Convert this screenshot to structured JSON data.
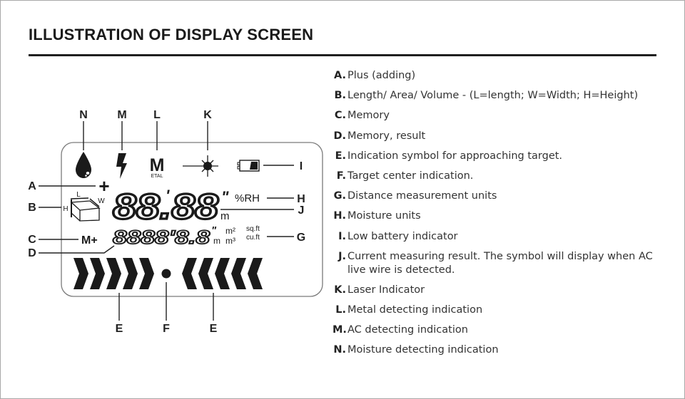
{
  "page": {
    "title": "ILLUSTRATION OF DISPLAY SCREEN"
  },
  "diagram": {
    "callouts": {
      "A": "A",
      "B": "B",
      "C": "C",
      "D": "D",
      "E": "E",
      "F": "F",
      "G": "G",
      "H": "H",
      "I": "I",
      "J": "J",
      "K": "K",
      "L": "L",
      "M": "M",
      "N": "N"
    },
    "lcd": {
      "metal_icon_letter": "M",
      "metal_icon_sub": "ETAL",
      "plus_symbol": "+",
      "box_labels": {
        "length": "L",
        "width": "W",
        "height": "H"
      },
      "memory_plus": "M+",
      "main_digits": "88.88",
      "main_foot_mark": "'",
      "main_inch_mark": "\"",
      "main_unit_rh": "%RH",
      "main_unit_m": "m",
      "sub_digits": "8888'8.8",
      "sub_inch_mark": "\"",
      "sub_unit_m2": "m²",
      "sub_unit_m": "m",
      "sub_unit_m3": "m³",
      "sub_unit_sqft": "sq.ft",
      "sub_unit_cuft": "cu.ft",
      "approach_left_count": 5,
      "approach_right_count": 5
    }
  },
  "legend": {
    "items": [
      {
        "key": "A.",
        "text": "Plus (adding)"
      },
      {
        "key": "B.",
        "text": "Length/ Area/ Volume - (L=length; W=Width; H=Height)"
      },
      {
        "key": "C.",
        "text": "Memory"
      },
      {
        "key": "D.",
        "text": "Memory, result"
      },
      {
        "key": "E.",
        "text": "Indication symbol for approaching target."
      },
      {
        "key": "F.",
        "text": "Target center indication."
      },
      {
        "key": "G.",
        "text": "Distance measurement units"
      },
      {
        "key": "H.",
        "text": "Moisture units"
      },
      {
        "key": "I.",
        "text": "Low battery indicator"
      },
      {
        "key": "J.",
        "text": "Current measuring result. The symbol will display when AC live wire is detected."
      },
      {
        "key": "K.",
        "text": "Laser Indicator"
      },
      {
        "key": "L.",
        "text": "Metal detecting indication"
      },
      {
        "key": "M.",
        "text": "AC detecting indication"
      },
      {
        "key": "N.",
        "text": "Moisture detecting indication"
      }
    ]
  }
}
